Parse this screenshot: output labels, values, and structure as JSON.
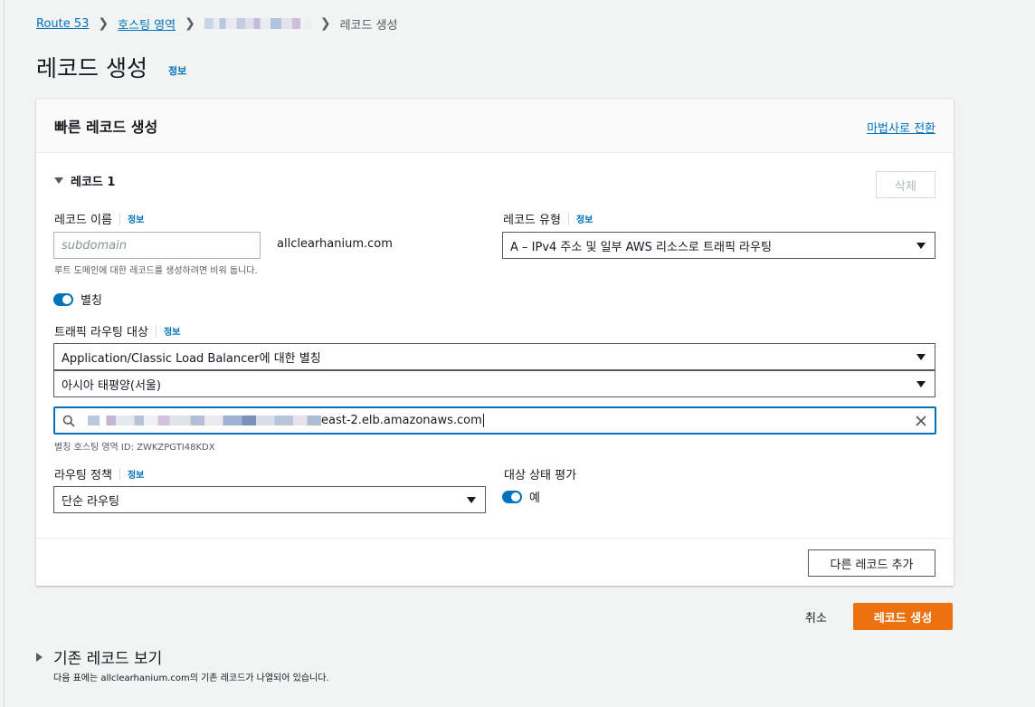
{
  "breadcrumb": {
    "route53": "Route 53",
    "hosted_zones": "호스팅 영역",
    "current": "레코드 생성"
  },
  "page": {
    "title": "레코드 생성",
    "info": "정보"
  },
  "panel": {
    "title": "빠른 레코드 생성",
    "wizard_link": "마법사로 전환",
    "record_header": "레코드 1",
    "delete_label": "삭제",
    "record_name": {
      "label": "레코드 이름",
      "info": "정보",
      "placeholder": "subdomain",
      "domain_suffix": "allclearhanium.com",
      "hint": "루트 도메인에 대한 레코드를 생성하려면 비워 둡니다."
    },
    "record_type": {
      "label": "레코드 유형",
      "info": "정보",
      "value": "A – IPv4 주소 및 일부 AWS 리소스로 트래픽 라우팅"
    },
    "alias": {
      "label": "별칭",
      "enabled": true
    },
    "traffic_target": {
      "label": "트래픽 라우팅 대상",
      "info": "정보",
      "endpoint": "Application/Classic Load Balancer에 대한 별칭",
      "region": "아시아 태평양(서울)",
      "search_value_suffix": "east-2.elb.amazonaws.com",
      "hosted_zone_id": "별칭 호스팅 영역 ID: ZWKZPGTI48KDX"
    },
    "routing_policy": {
      "label": "라우팅 정책",
      "info": "정보",
      "value": "단순 라우팅"
    },
    "health": {
      "label": "대상 상태 평가",
      "value": "예",
      "enabled": true
    },
    "add_record_label": "다른 레코드 추가"
  },
  "actions": {
    "cancel": "취소",
    "create": "레코드 생성"
  },
  "existing": {
    "title": "기존 레코드 보기",
    "description": "다음 표에는 allclearhanium.com의 기존 레코드가 나열되어 있습니다."
  },
  "colors": {
    "link": "#0073bb",
    "primary_button": "#ec7211",
    "toggle_on": "#0073bb"
  }
}
